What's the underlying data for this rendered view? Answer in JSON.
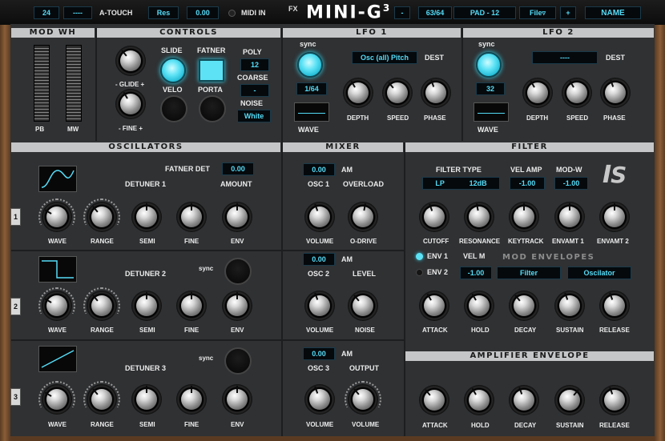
{
  "topbar": {
    "program": "24",
    "dash1": "----",
    "atouch": "A-TOUCH",
    "res": "Res",
    "value": "0.00",
    "midi_in": "MIDI IN",
    "fx": "FX",
    "logo": "MINI-G",
    "logo_sup": "3",
    "minus": "-",
    "preset_count": "63/64",
    "preset_name": "PAD - 12",
    "file": "File▿",
    "plus": "+",
    "name": "NAME"
  },
  "sections": {
    "mod_wh": "MOD WH",
    "controls": "CONTROLS",
    "lfo1": "LFO 1",
    "lfo2": "LFO 2",
    "oscillators": "OSCILLATORS",
    "mixer": "MIXER",
    "filter": "FILTER",
    "amp_env": "AMPLIFIER ENVELOPE",
    "mod_env": "MOD ENVELOPES"
  },
  "modwh": {
    "pb": "PB",
    "mw": "MW"
  },
  "controls": {
    "glide": "- GLIDE +",
    "fine": "- FINE +",
    "slide": "SLIDE",
    "fatner": "FATNER",
    "velo": "VELO",
    "porta": "PORTA",
    "poly": "POLY",
    "poly_val": "12",
    "coarse": "COARSE",
    "coarse_val": "-",
    "noise": "NOISE",
    "noise_val": "White"
  },
  "lfo1": {
    "sync": "sync",
    "rate": "1/64",
    "wave": "WAVE",
    "dest_val": "Osc (all) Pitch",
    "dest": "DEST",
    "depth": "DEPTH",
    "speed": "SPEED",
    "phase": "PHASE"
  },
  "lfo2": {
    "sync": "sync",
    "rate": "32",
    "wave": "WAVE",
    "dest_val": "----",
    "dest": "DEST",
    "depth": "DEPTH",
    "speed": "SPEED",
    "phase": "PHASE"
  },
  "osc": {
    "fatner_det": "FATNER DET",
    "fatner_det_val": "0.00",
    "amount": "AMOUNT",
    "detuner1": "DETUNER 1",
    "detuner2": "DETUNER 2",
    "detuner3": "DETUNER 3",
    "sync": "sync",
    "wave": "WAVE",
    "range": "RANGE",
    "semi": "SEMI",
    "fine": "FINE",
    "env": "ENV",
    "tab1": "1",
    "tab2": "2",
    "tab3": "3"
  },
  "mixer": {
    "am": "AM",
    "osc1_val": "0.00",
    "osc1": "OSC 1",
    "overload": "OVERLOAD",
    "osc2_val": "0.00",
    "osc2": "OSC 2",
    "level": "LEVEL",
    "osc3_val": "0.00",
    "osc3": "OSC 3",
    "output": "OUTPUT",
    "volume": "VOLUME",
    "odrive": "O-DRIVE",
    "noise": "NOISE"
  },
  "filter": {
    "type_label": "FILTER TYPE",
    "type_val": "LP",
    "type_slope": "12dB",
    "vel_amp": "VEL AMP",
    "vel_amp_val": "-1.00",
    "mod_w": "MOD-W",
    "mod_w_val": "-1.00",
    "cutoff": "CUTOFF",
    "resonance": "RESONANCE",
    "keytrack": "KEYTRACK",
    "envamt1": "ENVAMT 1",
    "envamt2": "ENVAMT 2",
    "env1": "ENV 1",
    "env2": "ENV 2",
    "vel_m": "VEL M",
    "vel_m_val": "-1.00",
    "target1": "Filter",
    "target2": "Oscilator",
    "attack": "ATTACK",
    "hold": "HOLD",
    "decay": "DECAY",
    "sustain": "SUSTAIN",
    "release": "RELEASE"
  },
  "colors": {
    "accent": "#55dcf7",
    "panel": "#2f3133",
    "header": "#c4c6c8"
  }
}
